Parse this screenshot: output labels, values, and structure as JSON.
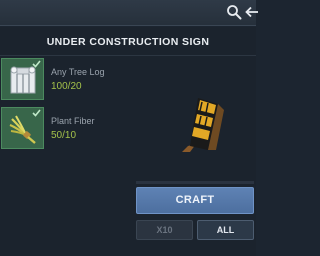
{
  "recipe": {
    "title": "UNDER CONSTRUCTION SIGN"
  },
  "ingredients": [
    {
      "name": "Any Tree Log",
      "count": "100/20",
      "icon": "tree-log-icon",
      "status": "fulfilled"
    },
    {
      "name": "Plant Fiber",
      "count": "50/10",
      "icon": "plant-fiber-icon",
      "status": "fulfilled"
    }
  ],
  "actions": {
    "craft_label": "CRAFT",
    "x10_label": "X10",
    "all_label": "ALL"
  },
  "colors": {
    "fulfilled_slot": "#38664a",
    "count_text": "#a4c24a",
    "craft_button": "#5a7eb0"
  },
  "icons": {
    "topbar": [
      "search-icon",
      "back-arrow-icon"
    ],
    "preview": "under-construction-sign-icon",
    "check": "checkmark-icon"
  }
}
